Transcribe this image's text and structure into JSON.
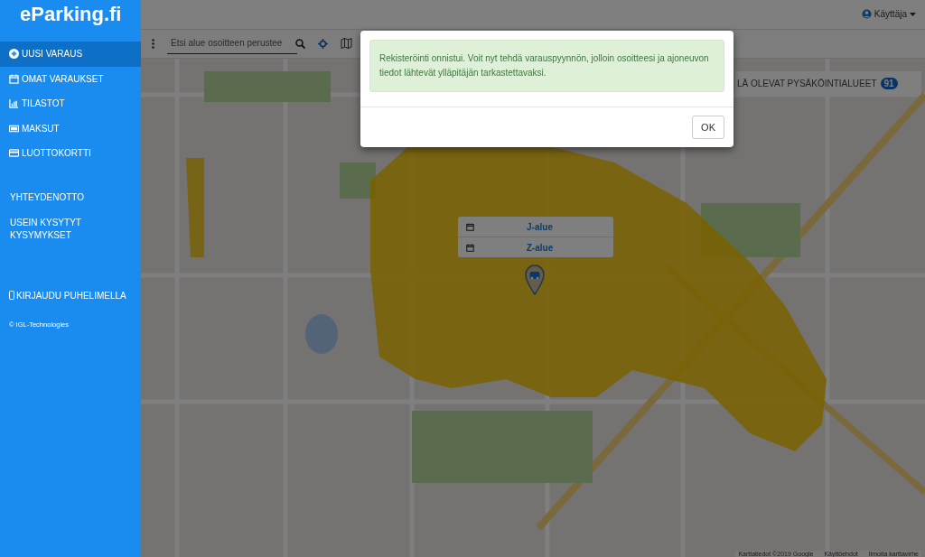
{
  "logo": "eParking.fi",
  "sidebar": {
    "items": [
      {
        "label": "UUSI VARAUS",
        "kind": "plus",
        "selected": true
      },
      {
        "label": "OMAT VARAUKSET",
        "kind": "calendar",
        "selected": false
      },
      {
        "label": "TILASTOT",
        "kind": "chart",
        "selected": false
      },
      {
        "label": "MAKSUT",
        "kind": "money",
        "selected": false
      },
      {
        "label": "LUOTTOKORTTI",
        "kind": "card",
        "selected": false
      }
    ],
    "links": [
      "YHTEYDENOTTO",
      "USEIN KYSYTYT KYSYMYKSET"
    ],
    "phone_login": "KIRJAUDU PUHELIMELLA",
    "copyright": "© IGL-Technologies"
  },
  "user_menu": {
    "label": "Käyttäja"
  },
  "search": {
    "placeholder": "Etsi alue osoitteen perustee"
  },
  "areas_panel": {
    "title": "LÄ OLEVAT PYSÄKÖINTIALUEET",
    "count": "91"
  },
  "map_popup": {
    "items": [
      {
        "label": "J-alue"
      },
      {
        "label": "Z-alue"
      }
    ]
  },
  "map_attribution": [
    "Karttatiedot ©2019 Google",
    "Käyttöehdot",
    "Ilmoita karttavirhe"
  ],
  "modal": {
    "message": "Rekisteröinti onnistui. Voit nyt tehdä varauspyynnön, jolloin osoitteesi ja ajoneuvon tiedot lähtevät ylläpitäjän tarkastettavaksi.",
    "button": "OK"
  }
}
